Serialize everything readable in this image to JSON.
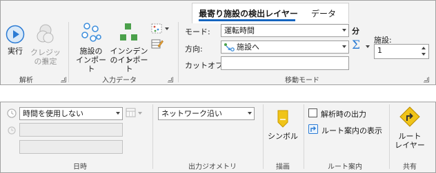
{
  "tabs": {
    "active": "最寄り施設の検出レイヤー",
    "other": "データ"
  },
  "ribbon": {
    "run_label": "実行",
    "credits_label_1": "クレジット",
    "credits_label_2": "の推定",
    "group_analysis": "解析",
    "import_facilities_1": "施設の",
    "import_facilities_2": "インポート",
    "import_incidents_1": "インシデント",
    "import_incidents_2": "のインポート",
    "group_input": "入力データ",
    "mode_label": "モード:",
    "mode_value": "運転時間",
    "unit_label": "分",
    "direction_label": "方向:",
    "direction_value": "施設へ",
    "cutoff_label": "カットオフ:",
    "cutoff_value": "",
    "facilities_label": "施設:",
    "facilities_value": "1",
    "group_travel": "移動モード"
  },
  "lower": {
    "time_value": "時間を使用しない",
    "time_field_2": "",
    "time_field_3": "",
    "group_datetime": "日時",
    "geometry_value": "ネットワーク沿い",
    "group_geometry": "出力ジオメトリ",
    "symbol_label": "シンボル",
    "group_draw": "描画",
    "checkbox_label": "解析時の出力",
    "route_directions_label": "ルート案内の表示",
    "group_directions": "ルート案内",
    "route_layer_1": "ルート",
    "route_layer_2": "レイヤー",
    "group_share": "共有"
  },
  "colors": {
    "accent_blue": "#2b7bd4",
    "tab_underline": "#1565c0",
    "square_green": "#4ba04b",
    "circle_blue": "#3f8fdc",
    "sign_yellow": "#f0c419"
  }
}
